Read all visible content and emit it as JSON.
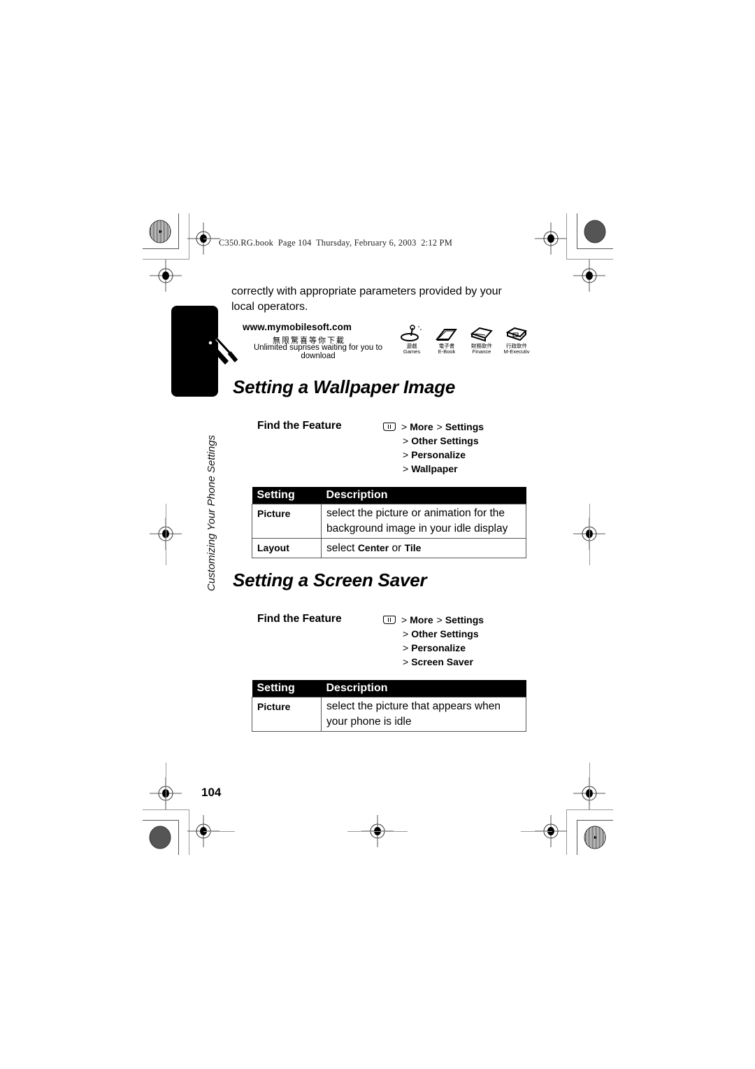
{
  "print_header": "C350.RG.book  Page 104  Thursday, February 6, 2003  2:12 PM",
  "side_tab": {
    "icon": "wrench-screwdriver-icon",
    "label": "Customizing Your Phone Settings"
  },
  "intro_text": "correctly with appropriate parameters provided by your local operators.",
  "ad": {
    "url": "www.mymobilesoft.com",
    "chinese_slogan": "無限驚喜等你下載",
    "english_slogan": "Unlimited suprises waiting for you to download",
    "categories": [
      {
        "cn": "遊戲",
        "en": "Games",
        "icon": "joystick-icon"
      },
      {
        "cn": "電子書",
        "en": "E-Book",
        "icon": "book-icon"
      },
      {
        "cn": "財務軟件",
        "en": "Finance",
        "icon": "calculator-icon"
      },
      {
        "cn": "行政軟件",
        "en": "M-Executiv",
        "icon": "briefcase-icon"
      }
    ]
  },
  "sections": [
    {
      "title": "Setting a Wallpaper Image",
      "find_feature_label": "Find the Feature",
      "menu_icon": "menu-key-icon",
      "path": [
        "More",
        "Settings",
        "Other Settings",
        "Personalize",
        "Wallpaper"
      ],
      "table": {
        "headers": [
          "Setting",
          "Description"
        ],
        "rows": [
          {
            "setting": "Picture",
            "description": "select the picture or animation for the background image in your idle display"
          },
          {
            "setting": "Layout",
            "description_prefix": "select ",
            "option_a": "Center",
            "joiner": " or ",
            "option_b": "Tile"
          }
        ]
      }
    },
    {
      "title": "Setting a Screen Saver",
      "find_feature_label": "Find the Feature",
      "menu_icon": "menu-key-icon",
      "path": [
        "More",
        "Settings",
        "Other Settings",
        "Personalize",
        "Screen Saver"
      ],
      "table": {
        "headers": [
          "Setting",
          "Description"
        ],
        "rows": [
          {
            "setting": "Picture",
            "description": "select the picture that appears when your phone is idle"
          }
        ]
      }
    }
  ],
  "page_number": "104"
}
